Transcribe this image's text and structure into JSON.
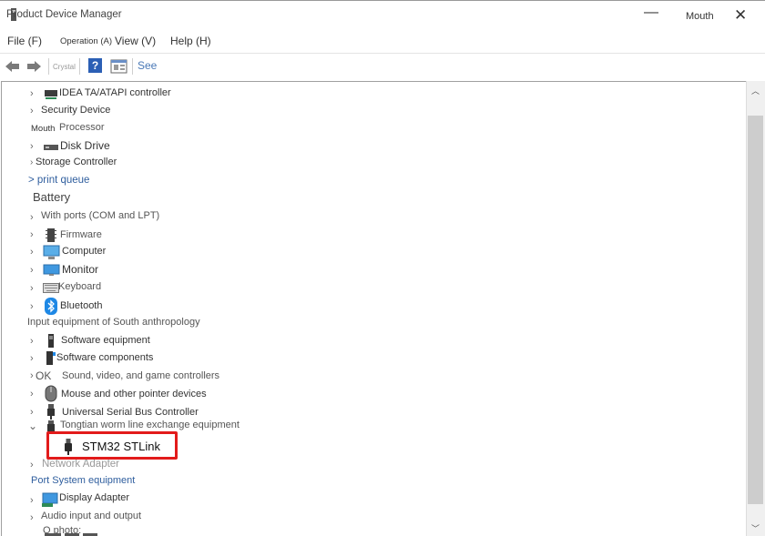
{
  "window": {
    "title": "Product Device Manager",
    "minimize": "—",
    "user_label": "Mouth",
    "close": "✕"
  },
  "menu": {
    "file": "File (F)",
    "operation": "Operation (A)",
    "view": "View (V)",
    "help": "Help (H)"
  },
  "toolbar": {
    "crystal": "Crystal",
    "help_symbol": "?",
    "see": "See"
  },
  "tree": [
    {
      "label": "IDEA TA/ATAPI controller",
      "chevron": "›",
      "icon": "ide-controller-icon"
    },
    {
      "label": "Security Device",
      "chevron": "›",
      "icon": "security-device-icon"
    },
    {
      "prefix": "Mouth",
      "label": "Processor",
      "chevron": "",
      "icon": "processor-icon"
    },
    {
      "label": "Disk Drive",
      "chevron": "›",
      "icon": "disk-drive-icon"
    },
    {
      "label": "Storage Controller",
      "chevron": "›",
      "icon": "storage-controller-icon"
    },
    {
      "label": "> print queue",
      "chevron": "",
      "icon": ""
    },
    {
      "label": "Battery",
      "chevron": "",
      "icon": "battery-icon"
    },
    {
      "label": "With ports (COM and LPT)",
      "chevron": "›",
      "icon": "port-icon"
    },
    {
      "label": "Firmware",
      "chevron": "›",
      "icon": "firmware-icon"
    },
    {
      "label": "Computer",
      "chevron": "›",
      "icon": "computer-icon"
    },
    {
      "label": "Monitor",
      "chevron": "›",
      "icon": "monitor-icon"
    },
    {
      "label": "Keyboard",
      "chevron": "›",
      "icon": "keyboard-icon"
    },
    {
      "label": "Bluetooth",
      "chevron": "›",
      "icon": "bluetooth-icon"
    },
    {
      "label": "Input equipment of South anthropology",
      "chevron": "",
      "icon": ""
    },
    {
      "label": "Software equipment",
      "chevron": "›",
      "icon": "software-device-icon"
    },
    {
      "label": "Software components",
      "chevron": "›",
      "icon": "software-component-icon"
    },
    {
      "prefix": "OK",
      "label": "Sound, video, and game controllers",
      "chevron": "›",
      "icon": ""
    },
    {
      "label": "Mouse and other pointer devices",
      "chevron": "›",
      "icon": "mouse-icon"
    },
    {
      "label": "Universal Serial Bus Controller",
      "chevron": "›",
      "icon": "usb-icon"
    },
    {
      "label": "Tongtian worm line exchange equipment",
      "chevron": "⌄",
      "icon": "usb-device-icon"
    },
    {
      "label": "STM32 STLink",
      "chevron": "",
      "icon": "usb-plug-icon"
    },
    {
      "label": "Network Adapter",
      "chevron": "›",
      "icon": "network-adapter-icon"
    },
    {
      "label": "Port System equipment",
      "chevron": "",
      "icon": ""
    },
    {
      "label": "Display Adapter",
      "chevron": "›",
      "icon": "display-adapter-icon"
    },
    {
      "label": "Audio input and output",
      "chevron": "›",
      "icon": ""
    },
    {
      "label": "Q photo:",
      "chevron": "",
      "icon": "camera-icon"
    }
  ],
  "colors": {
    "highlight": "#e21b1b",
    "accent": "#1e88e5"
  }
}
